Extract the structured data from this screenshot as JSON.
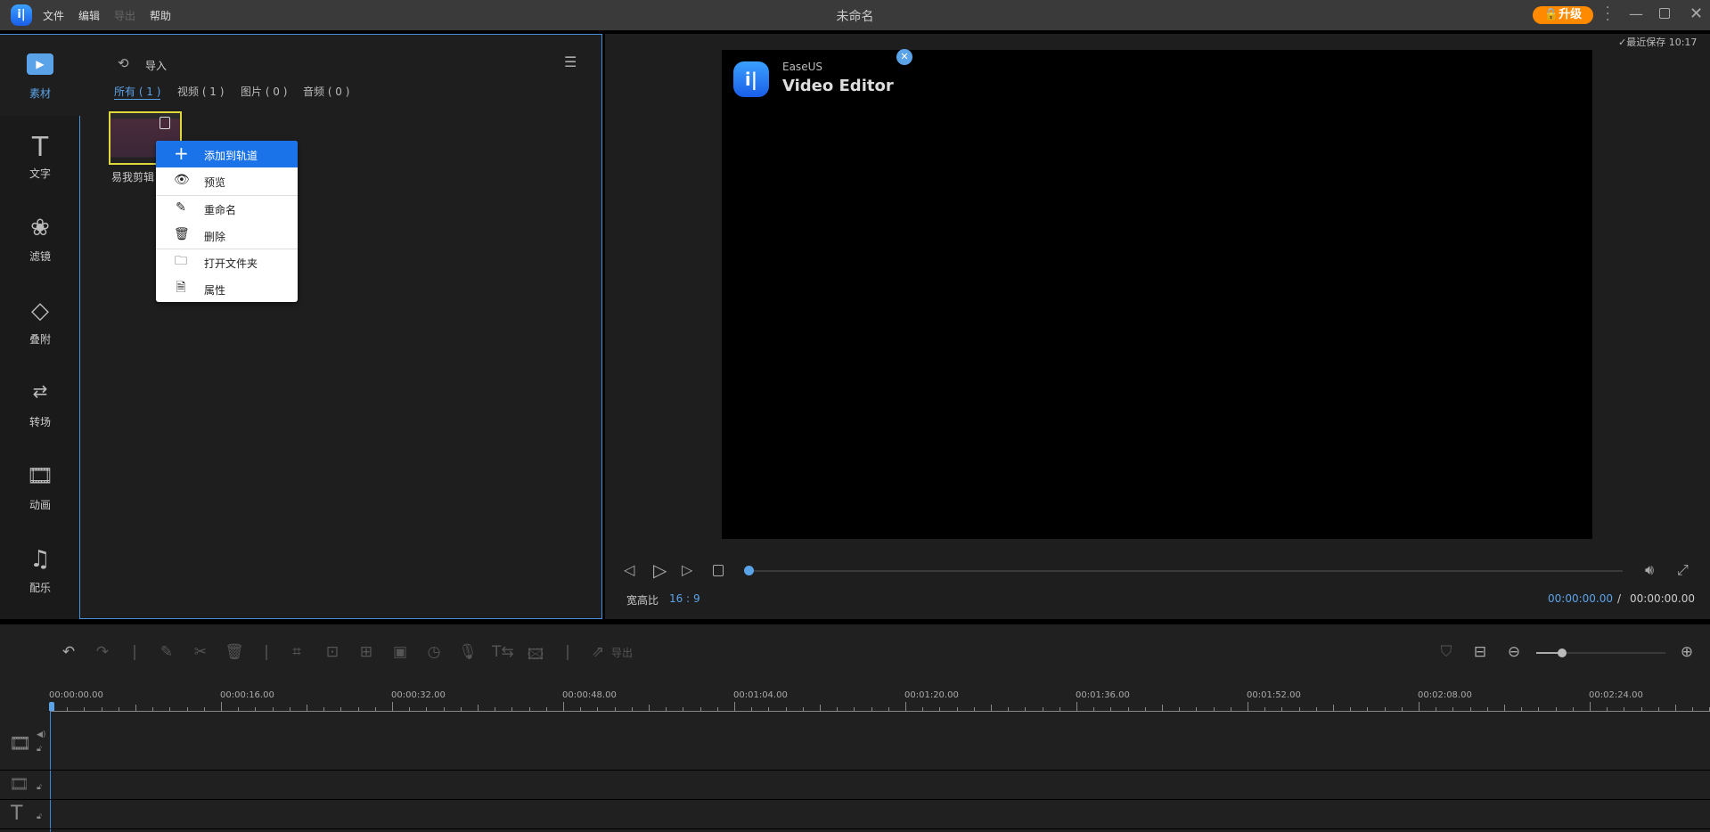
{
  "titlebar": {
    "title": "未命名",
    "menu": [
      "文件",
      "编辑",
      "导出",
      "帮助"
    ],
    "upgrade": "升级",
    "saved": "最近保存 10:17"
  },
  "sidebar": {
    "items": [
      {
        "label": "素材",
        "icon": "media-icon"
      },
      {
        "label": "文字",
        "icon": "text-icon"
      },
      {
        "label": "滤镜",
        "icon": "filter-icon"
      },
      {
        "label": "叠附",
        "icon": "overlay-icon"
      },
      {
        "label": "转场",
        "icon": "transition-icon"
      },
      {
        "label": "动画",
        "icon": "animation-icon"
      },
      {
        "label": "配乐",
        "icon": "music-icon"
      }
    ]
  },
  "media": {
    "import": "导入",
    "tabs": [
      "所有 ( 1 )",
      "视频 ( 1 )",
      "图片 ( 0 )",
      "音频 ( 0 )"
    ],
    "active_tab": 0,
    "file_name": "易我剪辑"
  },
  "context_menu": {
    "items": [
      "添加到轨道",
      "预览",
      "重命名",
      "删除",
      "打开文件夹",
      "属性"
    ],
    "highlighted": 0
  },
  "preview": {
    "brand_small": "EaseUS",
    "brand_big": "Video Editor",
    "aspect_label": "宽高比",
    "aspect_value": "16 : 9",
    "current_time": "00:00:00.00",
    "total_time": "00:00:00.00",
    "progress": 0
  },
  "timeline": {
    "export": "导出",
    "zoom_level": 0.2,
    "ruler": [
      "00:00:00.00",
      "00:00:16.00",
      "00:00:32.00",
      "00:00:48.00",
      "00:01:04.00",
      "00:01:20.00",
      "00:01:36.00",
      "00:01:52.00",
      "00:02:08.00",
      "00:02:24.00"
    ]
  },
  "colors": {
    "accent": "#4a90d9",
    "menu_highlight": "#1a73e8",
    "upgrade": "#ff8a00"
  }
}
